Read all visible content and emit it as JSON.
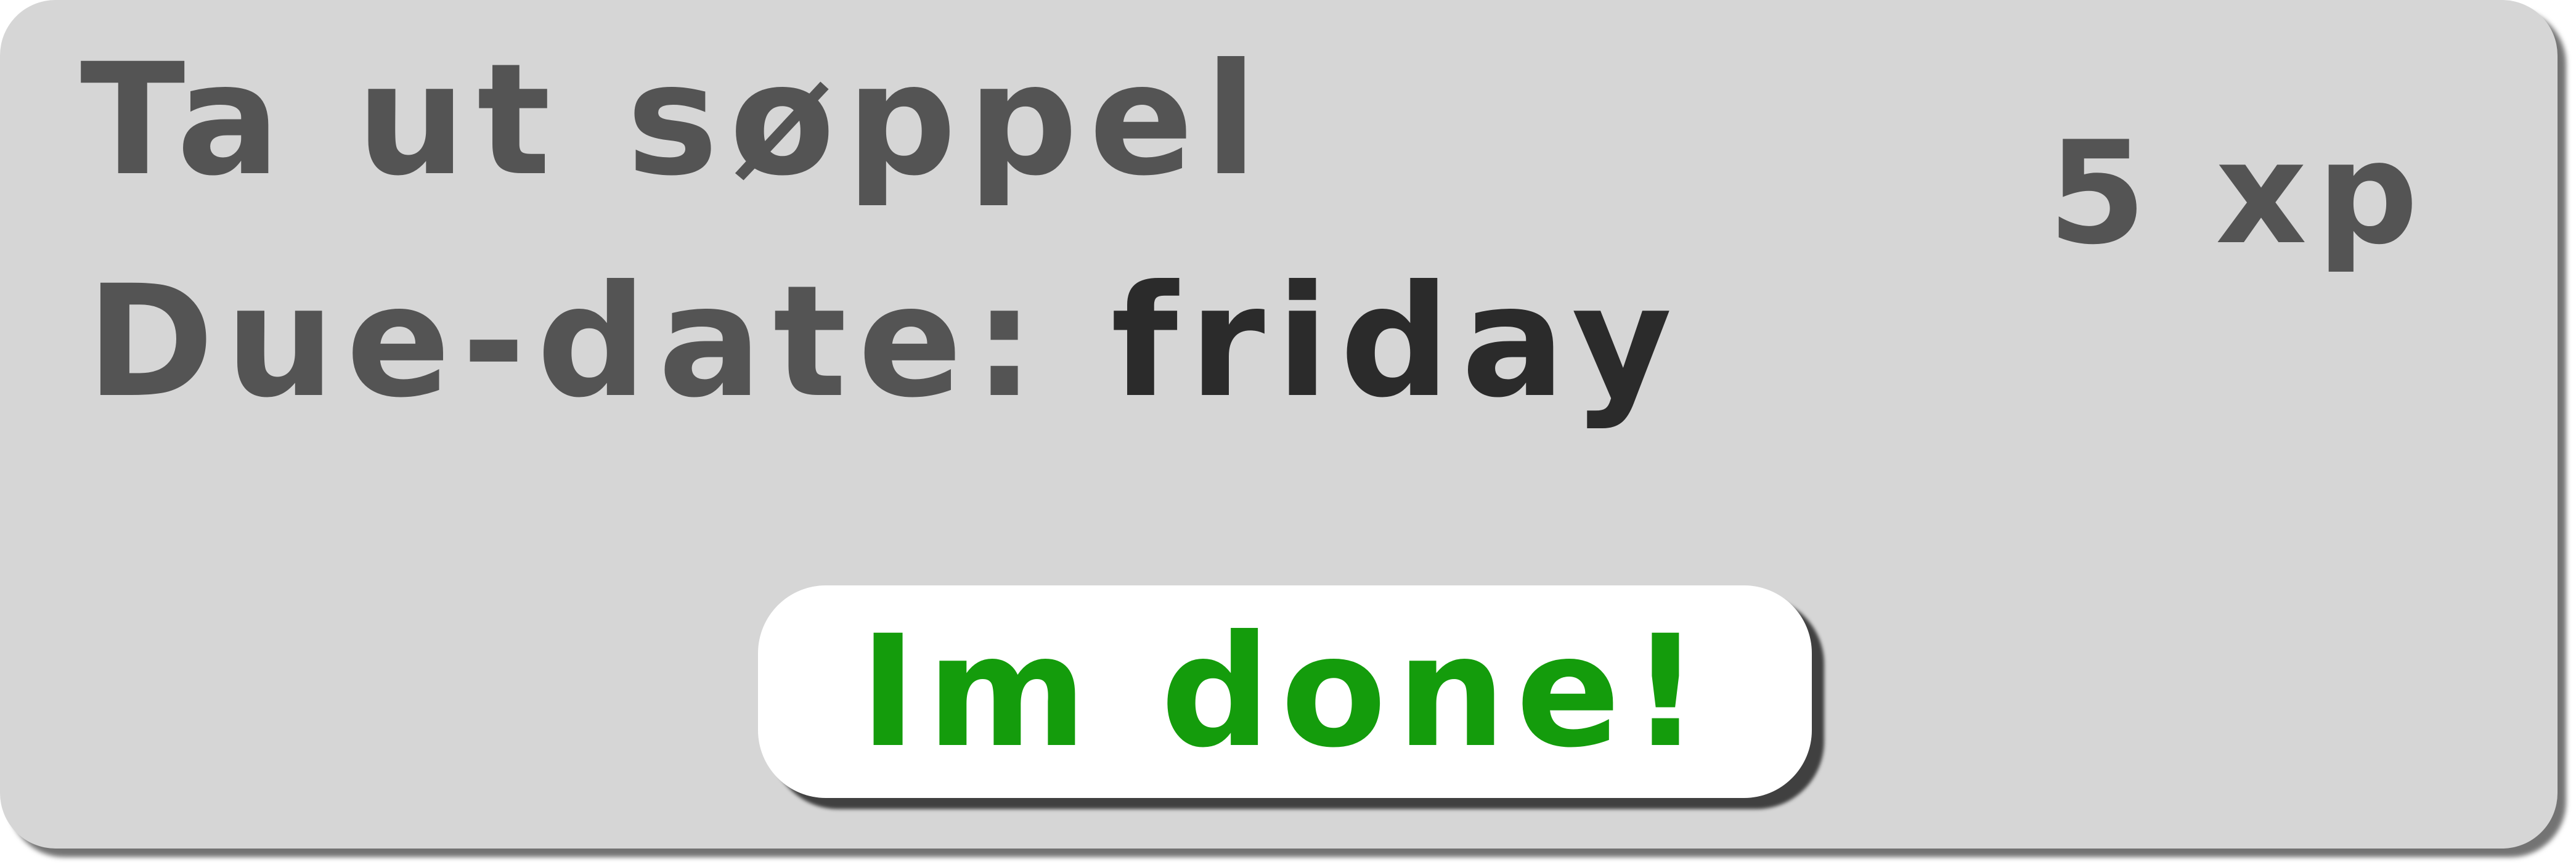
{
  "task": {
    "title": "Ta ut søppel",
    "due_label": "Due-date: ",
    "due_value": "friday",
    "xp": "5 xp"
  },
  "actions": {
    "done_label": "Im done!"
  },
  "colors": {
    "card_background": "#d6d6d6",
    "text_primary": "#545454",
    "text_emphasis": "#2b2b2b",
    "button_background": "#ffffff",
    "button_text": "#149c0c"
  }
}
